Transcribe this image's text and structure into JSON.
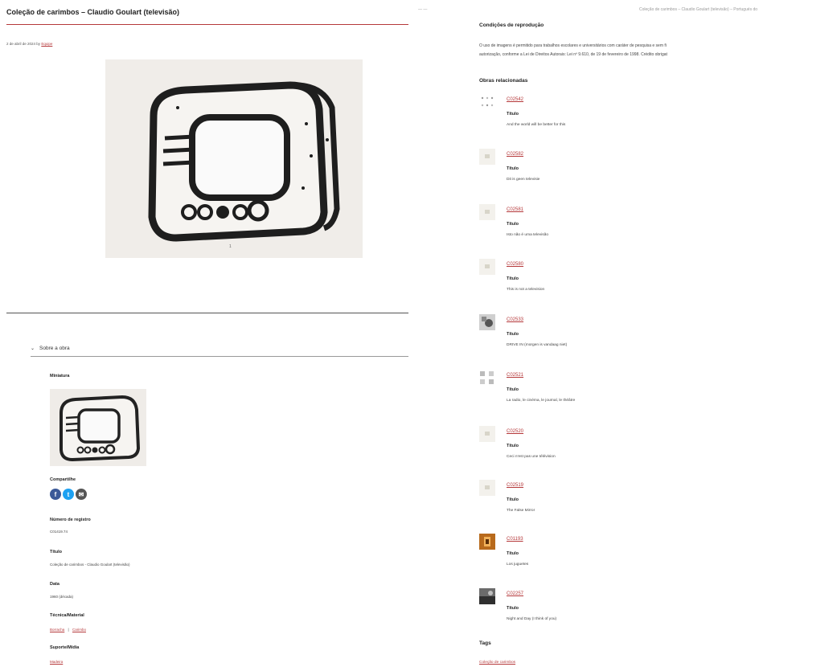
{
  "left": {
    "title": "Coleção de carimbos – Claudio Goulart (televisão)",
    "meta_date": "2 de abril de 2024 by",
    "meta_author": "Equipe",
    "hero_index": "1",
    "accordion_label": "Sobre a obra",
    "miniatura_label": "Miniatura",
    "share_label": "Compartilhe",
    "share_icons": [
      "facebook-icon",
      "twitter-icon",
      "email-icon"
    ],
    "share_colors": [
      "#3b5998",
      "#1da1f2",
      "#555555"
    ],
    "fields": [
      {
        "label": "Número de registro",
        "value": "C01419.74"
      },
      {
        "label": "Título",
        "value": "Coleção de carimbos - Claudio Goulart (televisão)"
      },
      {
        "label": "Data",
        "value": "1960 (década)"
      }
    ],
    "tecnica_label": "Técnica/Material",
    "tecnica_links": [
      "Borracha",
      "Carimbo"
    ],
    "tecnica_sep": "|",
    "suporte_label": "Suporte/Mídia",
    "suporte_link": "Madeira"
  },
  "right": {
    "top_crumb": "Coleção de carimbos – Claudio Goulart (televisão) – Portugués do",
    "conditions_title": "Condições de reprodução",
    "conditions_line1": "O uso de imagens é permitido para trabalhos escolares e universitários com caráter de pesquisa e sem fi",
    "conditions_line2": "autorização, conforme a Lei de Direitos Autorais: Lei nº 9.610, de 19 de fevereiro de 1998. Crédito obrigat",
    "related_title": "Obras relacionadas",
    "title_label": "Título",
    "related": [
      {
        "code": "C02542",
        "title": "And the world will be better for this"
      },
      {
        "code": "C02582",
        "title": "Dit is geen televisie"
      },
      {
        "code": "C02581",
        "title": "Isto não é uma televisão"
      },
      {
        "code": "C02580",
        "title": "This is not a television"
      },
      {
        "code": "C02533",
        "title": "DRIVE IN (morgen is vandaag niet)"
      },
      {
        "code": "C02521",
        "title": "La radio, le cinéma, le journal, le théâtre"
      },
      {
        "code": "C02520",
        "title": "Ceci n'est pas une télévision"
      },
      {
        "code": "C02519",
        "title": "The False Mirror"
      },
      {
        "code": "C01193",
        "title": "Los juguetes"
      },
      {
        "code": "C02257",
        "title": "Night and Day (I think of you)"
      }
    ],
    "tags_title": "Tags",
    "tag_link": "Coleção de carimbos"
  }
}
